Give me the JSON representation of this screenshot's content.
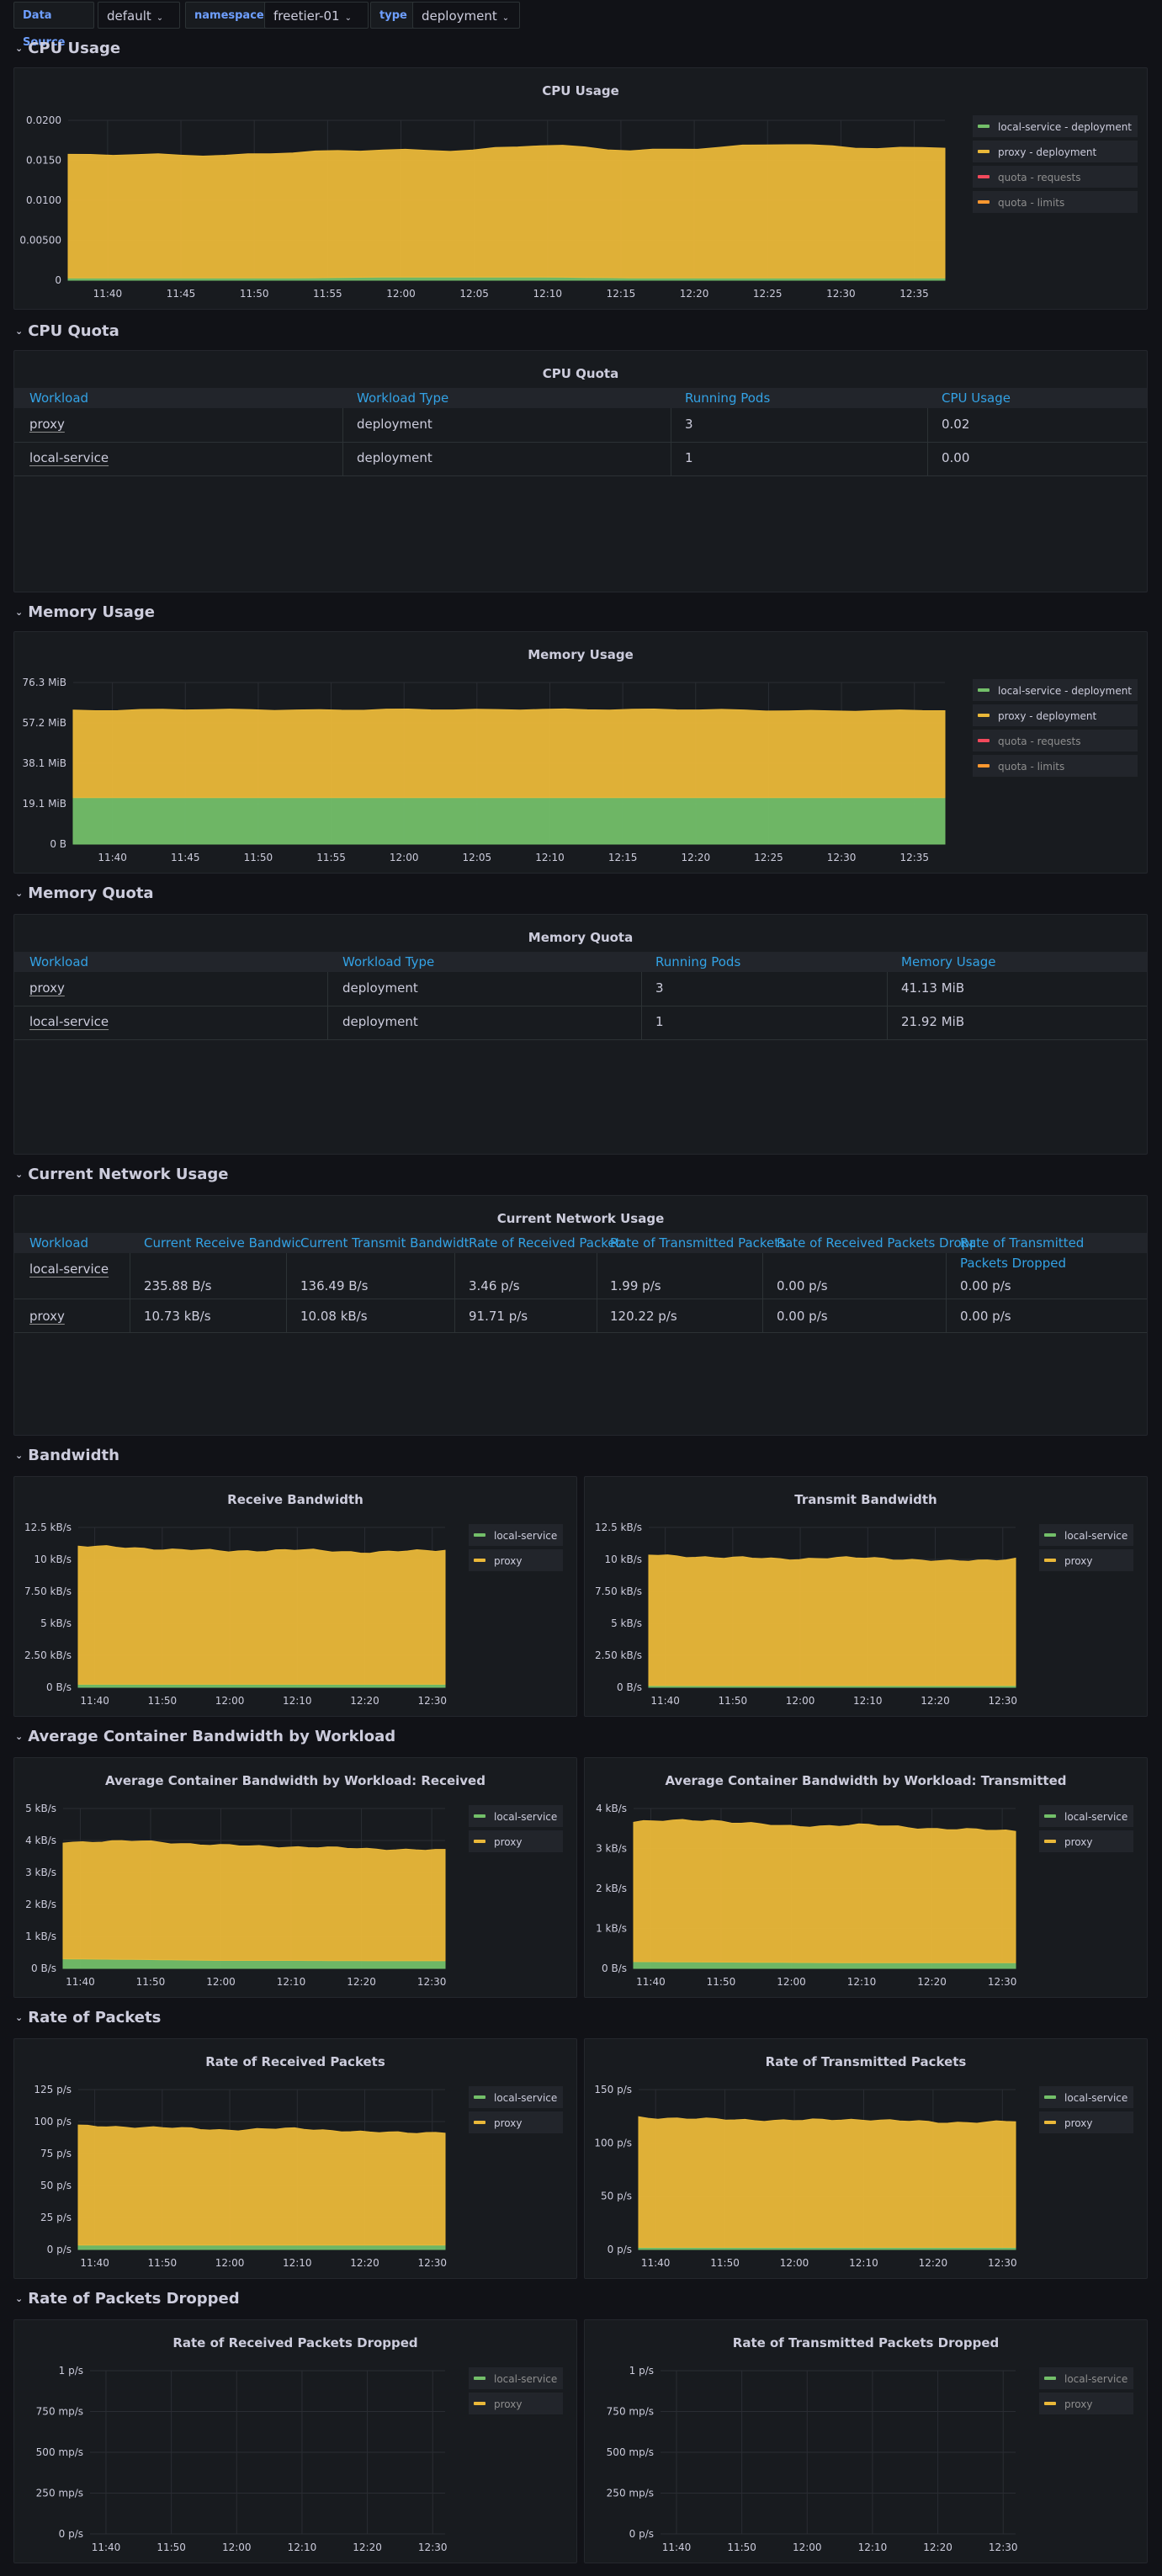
{
  "variables": [
    {
      "label": "Data Source",
      "value": "default"
    },
    {
      "label": "namespace",
      "value": "freetier-01"
    },
    {
      "label": "type",
      "value": "deployment"
    }
  ],
  "colors": {
    "local_service": "#73bf69",
    "proxy": "#eab839",
    "quota_requests": "#f2495c",
    "quota_limits": "#ff9830",
    "link_header": "#33a2e5"
  },
  "rows": {
    "cpu_usage": "CPU Usage",
    "cpu_quota": "CPU Quota",
    "memory_usage": "Memory Usage",
    "memory_quota": "Memory Quota",
    "network_usage": "Current Network Usage",
    "bandwidth": "Bandwidth",
    "avg_bandwidth": "Average Container Bandwidth by Workload",
    "rate_packets": "Rate of Packets",
    "rate_dropped": "Rate of Packets Dropped"
  },
  "cpu_quota_table": {
    "title": "CPU Quota",
    "headers": [
      "Workload",
      "Workload Type",
      "Running Pods",
      "CPU Usage"
    ],
    "rows": [
      [
        "proxy",
        "deployment",
        "3",
        "0.02"
      ],
      [
        "local-service",
        "deployment",
        "1",
        "0.00"
      ]
    ]
  },
  "memory_quota_table": {
    "title": "Memory Quota",
    "headers": [
      "Workload",
      "Workload Type",
      "Running Pods",
      "Memory Usage"
    ],
    "rows": [
      [
        "proxy",
        "deployment",
        "3",
        "41.13 MiB"
      ],
      [
        "local-service",
        "deployment",
        "1",
        "21.92 MiB"
      ]
    ]
  },
  "network_table": {
    "title": "Current Network Usage",
    "headers": [
      "Workload",
      "Current Receive Bandwidth",
      "Current Transmit Bandwidth",
      "Rate of Received Packets",
      "Rate of Transmitted Packets",
      "Rate of Received Packets Dropped",
      "Rate of Transmitted Packets Dropped"
    ],
    "rows": [
      [
        "local-service",
        "235.88 B/s",
        "136.49 B/s",
        "3.46 p/s",
        "1.99 p/s",
        "0.00 p/s",
        "0.00 p/s"
      ],
      [
        "proxy",
        "10.73 kB/s",
        "10.08 kB/s",
        "91.71 p/s",
        "120.22 p/s",
        "0.00 p/s",
        "0.00 p/s"
      ]
    ]
  },
  "chart_data": [
    {
      "id": "cpu_usage",
      "type": "area",
      "title": "CPU Usage",
      "x": [
        "11:40",
        "11:45",
        "11:50",
        "11:55",
        "12:00",
        "12:05",
        "12:10",
        "12:15",
        "12:20",
        "12:25",
        "12:30",
        "12:35"
      ],
      "yticks": [
        "0",
        "0.00500",
        "0.0100",
        "0.0150",
        "0.0200"
      ],
      "ylim": [
        0,
        0.02
      ],
      "series": [
        {
          "name": "local-service - deployment",
          "values": [
            0.0003,
            0.0003,
            0.0003,
            0.0003,
            0.0004,
            0.0004,
            0.0004,
            0.0003,
            0.0003,
            0.0003,
            0.0003,
            0.0003
          ]
        },
        {
          "name": "proxy - deployment",
          "values": [
            0.0153,
            0.0155,
            0.0153,
            0.0157,
            0.016,
            0.0158,
            0.0165,
            0.016,
            0.0162,
            0.0167,
            0.0163,
            0.0163
          ]
        },
        {
          "name": "quota - requests",
          "values": []
        },
        {
          "name": "quota - limits",
          "values": []
        }
      ],
      "legend": "right"
    },
    {
      "id": "memory_usage",
      "type": "area",
      "title": "Memory Usage",
      "x": [
        "11:40",
        "11:45",
        "11:50",
        "11:55",
        "12:00",
        "12:05",
        "12:10",
        "12:15",
        "12:20",
        "12:25",
        "12:30",
        "12:35"
      ],
      "yticks": [
        "0 B",
        "19.1 MiB",
        "38.1 MiB",
        "57.2 MiB",
        "76.3 MiB"
      ],
      "ylim": [
        0,
        76.3
      ],
      "series": [
        {
          "name": "local-service - deployment",
          "values": [
            21.92,
            21.92,
            21.92,
            21.92,
            21.92,
            21.92,
            21.92,
            21.92,
            21.92,
            21.92,
            21.92,
            21.92
          ]
        },
        {
          "name": "proxy - deployment",
          "values": [
            41.3,
            41.6,
            41.4,
            41.5,
            41.7,
            41.3,
            41.9,
            41.6,
            41.4,
            41.2,
            41.0,
            41.1
          ]
        },
        {
          "name": "quota - requests",
          "values": []
        },
        {
          "name": "quota - limits",
          "values": []
        }
      ],
      "legend": "right"
    },
    {
      "id": "receive_bandwidth",
      "type": "area",
      "title": "Receive Bandwidth",
      "x": [
        "11:40",
        "11:50",
        "12:00",
        "12:10",
        "12:20",
        "12:30"
      ],
      "yticks": [
        "0 B/s",
        "2.50 kB/s",
        "5 kB/s",
        "7.50 kB/s",
        "10 kB/s",
        "12.5 kB/s"
      ],
      "ylim": [
        0,
        12.5
      ],
      "series": [
        {
          "name": "local-service",
          "values": [
            0.24,
            0.24,
            0.24,
            0.24,
            0.24,
            0.24
          ]
        },
        {
          "name": "proxy",
          "values": [
            10.8,
            10.6,
            10.4,
            10.5,
            10.3,
            10.5
          ]
        }
      ],
      "legend": "right"
    },
    {
      "id": "transmit_bandwidth",
      "type": "area",
      "title": "Transmit Bandwidth",
      "x": [
        "11:40",
        "11:50",
        "12:00",
        "12:10",
        "12:20",
        "12:30"
      ],
      "yticks": [
        "0 B/s",
        "2.50 kB/s",
        "5 kB/s",
        "7.50 kB/s",
        "10 kB/s",
        "12.5 kB/s"
      ],
      "ylim": [
        0,
        12.5
      ],
      "series": [
        {
          "name": "local-service",
          "values": [
            0.14,
            0.14,
            0.14,
            0.14,
            0.14,
            0.14
          ]
        },
        {
          "name": "proxy",
          "values": [
            10.2,
            10.0,
            9.9,
            10.0,
            9.7,
            9.9
          ]
        }
      ],
      "legend": "right"
    },
    {
      "id": "avg_received",
      "type": "area",
      "title": "Average Container Bandwidth by Workload: Received",
      "x": [
        "11:40",
        "11:50",
        "12:00",
        "12:10",
        "12:20",
        "12:30"
      ],
      "yticks": [
        "0 B/s",
        "1 kB/s",
        "2 kB/s",
        "3 kB/s",
        "4 kB/s",
        "5 kB/s"
      ],
      "ylim": [
        0,
        5
      ],
      "series": [
        {
          "name": "local-service",
          "values": [
            0.3,
            0.28,
            0.25,
            0.25,
            0.24,
            0.24
          ]
        },
        {
          "name": "proxy",
          "values": [
            3.65,
            3.7,
            3.6,
            3.55,
            3.5,
            3.45
          ]
        }
      ],
      "legend": "right"
    },
    {
      "id": "avg_transmitted",
      "type": "area",
      "title": "Average Container Bandwidth by Workload: Transmitted",
      "x": [
        "11:40",
        "11:50",
        "12:00",
        "12:10",
        "12:20",
        "12:30"
      ],
      "yticks": [
        "0 B/s",
        "1 kB/s",
        "2 kB/s",
        "3 kB/s",
        "4 kB/s"
      ],
      "ylim": [
        0,
        4
      ],
      "series": [
        {
          "name": "local-service",
          "values": [
            0.17,
            0.16,
            0.15,
            0.14,
            0.14,
            0.14
          ]
        },
        {
          "name": "proxy",
          "values": [
            3.5,
            3.55,
            3.4,
            3.45,
            3.35,
            3.3
          ]
        }
      ],
      "legend": "right"
    },
    {
      "id": "rate_received",
      "type": "area",
      "title": "Rate of Received Packets",
      "x": [
        "11:40",
        "11:50",
        "12:00",
        "12:10",
        "12:20",
        "12:30"
      ],
      "yticks": [
        "0 p/s",
        "25 p/s",
        "50 p/s",
        "75 p/s",
        "100 p/s",
        "125 p/s"
      ],
      "ylim": [
        0,
        125
      ],
      "series": [
        {
          "name": "local-service",
          "values": [
            3.5,
            3.5,
            3.4,
            3.5,
            3.4,
            3.5
          ]
        },
        {
          "name": "proxy",
          "values": [
            93,
            92,
            90,
            91,
            88,
            88
          ]
        }
      ],
      "legend": "right"
    },
    {
      "id": "rate_transmitted",
      "type": "area",
      "title": "Rate of Transmitted Packets",
      "x": [
        "11:40",
        "11:50",
        "12:00",
        "12:10",
        "12:20",
        "12:30"
      ],
      "yticks": [
        "0 p/s",
        "50 p/s",
        "100 p/s",
        "150 p/s"
      ],
      "ylim": [
        0,
        150
      ],
      "series": [
        {
          "name": "local-service",
          "values": [
            2,
            2,
            2,
            2,
            2,
            2
          ]
        },
        {
          "name": "proxy",
          "values": [
            122,
            120,
            119,
            120,
            117,
            118
          ]
        }
      ],
      "legend": "right"
    },
    {
      "id": "rate_received_dropped",
      "type": "area",
      "title": "Rate of Received Packets Dropped",
      "x": [
        "11:40",
        "11:50",
        "12:00",
        "12:10",
        "12:20",
        "12:30"
      ],
      "yticks": [
        "0 p/s",
        "250 mp/s",
        "500 mp/s",
        "750 mp/s",
        "1 p/s"
      ],
      "ylim": [
        0,
        1
      ],
      "series": [
        {
          "name": "local-service",
          "values": []
        },
        {
          "name": "proxy",
          "values": []
        }
      ],
      "legend": "right"
    },
    {
      "id": "rate_transmitted_dropped",
      "type": "area",
      "title": "Rate of Transmitted Packets Dropped",
      "x": [
        "11:40",
        "11:50",
        "12:00",
        "12:10",
        "12:20",
        "12:30"
      ],
      "yticks": [
        "0 p/s",
        "250 mp/s",
        "500 mp/s",
        "750 mp/s",
        "1 p/s"
      ],
      "ylim": [
        0,
        1
      ],
      "series": [
        {
          "name": "local-service",
          "values": []
        },
        {
          "name": "proxy",
          "values": []
        }
      ],
      "legend": "right"
    }
  ]
}
